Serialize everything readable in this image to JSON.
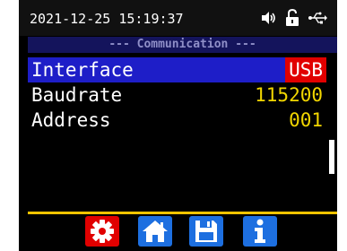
{
  "status_bar": {
    "datetime": "2021-12-25 15:19:37",
    "icons": [
      "speaker-icon",
      "lock-open-icon",
      "usb-icon"
    ]
  },
  "section": {
    "title": "--- Communication ---"
  },
  "settings": [
    {
      "label": "Interface",
      "value": "USB"
    },
    {
      "label": "Baudrate",
      "value": "115200"
    },
    {
      "label": "Address",
      "value": "001"
    }
  ],
  "toolbar": {
    "buttons": [
      "gear-icon",
      "home-icon",
      "save-icon",
      "info-icon"
    ]
  },
  "colors": {
    "selected_row": "#1e1ec8",
    "selected_value": "#e10000",
    "value_text": "#f2d600",
    "accent_divider": "#f2c400",
    "button_blue": "#1d6fe0",
    "button_red": "#e10000",
    "section_header": "#14145c"
  }
}
